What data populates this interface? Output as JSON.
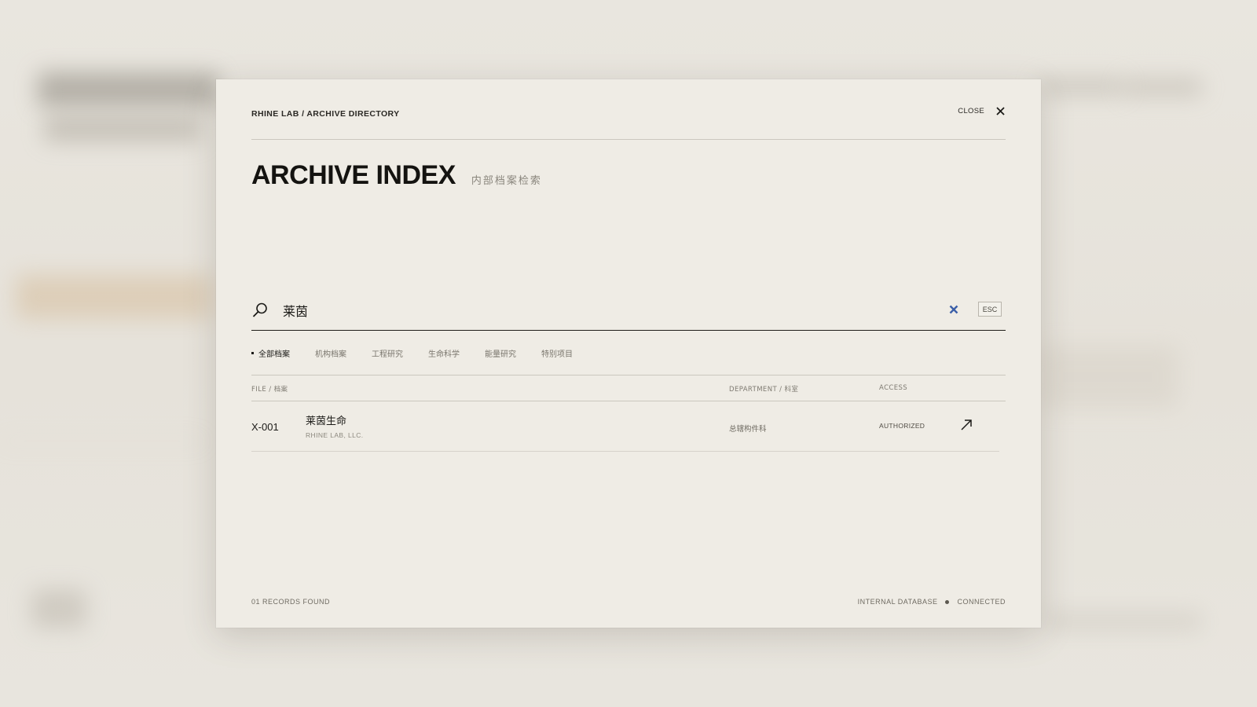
{
  "header": {
    "breadcrumb": "RHINE LAB / ARCHIVE DIRECTORY",
    "close_label": "CLOSE"
  },
  "title": {
    "main": "ARCHIVE INDEX",
    "subtitle": "内部档案检索"
  },
  "search": {
    "value": "莱茵",
    "esc_label": "ESC"
  },
  "tabs": [
    {
      "label": "全部档案",
      "active": true
    },
    {
      "label": "机构档案",
      "active": false
    },
    {
      "label": "工程研究",
      "active": false
    },
    {
      "label": "生命科学",
      "active": false
    },
    {
      "label": "能量研究",
      "active": false
    },
    {
      "label": "特别项目",
      "active": false
    }
  ],
  "table": {
    "columns": {
      "file": "FILE / 档案",
      "department": "DEPARTMENT / 科室",
      "access": "ACCESS"
    },
    "rows": [
      {
        "id": "X-001",
        "name": "莱茵生命",
        "org": "RHINE LAB, LLC.",
        "department": "总辖构件科",
        "access": "AUTHORIZED"
      }
    ]
  },
  "footer": {
    "records": "01 RECORDS FOUND",
    "database": "INTERNAL DATABASE",
    "status": "CONNECTED"
  },
  "colors": {
    "accent_clear": "#3b5fa8",
    "modal_bg": "#efece5",
    "text": "#1b1a17"
  }
}
